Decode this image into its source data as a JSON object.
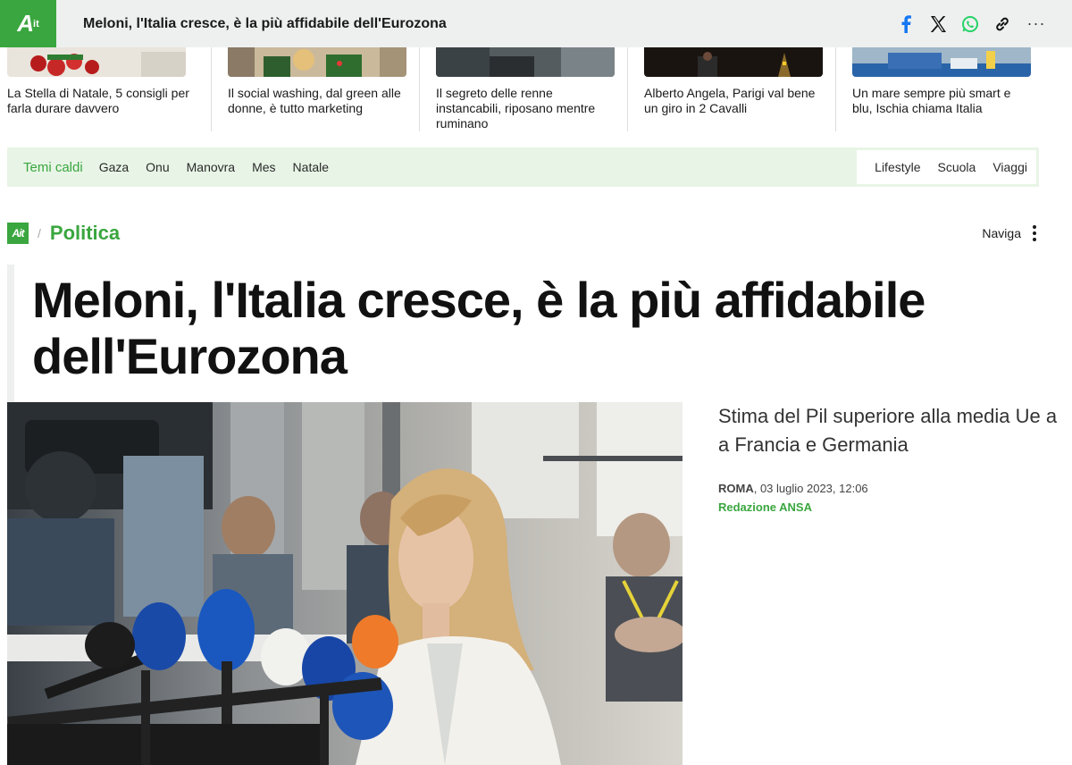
{
  "topbar": {
    "logo_text": "A",
    "logo_sup": "it",
    "title": "Meloni, l'Italia cresce, è la più affidabile dell'Eurozona",
    "share_icons": [
      "facebook-icon",
      "x-icon",
      "whatsapp-icon",
      "link-icon",
      "more-icon"
    ],
    "more_label": "···"
  },
  "related": [
    {
      "text": "La Stella di Natale, 5 consigli per farla durare davvero"
    },
    {
      "text": "Il social washing, dal green alle donne, è tutto marketing"
    },
    {
      "text": "Il segreto delle renne instancabili, riposano mentre ruminano"
    },
    {
      "text": "Alberto Angela, Parigi val bene un giro in 2 Cavalli"
    },
    {
      "text": "Un mare sempre più smart e blu, Ischia chiama Italia"
    }
  ],
  "hot_topics": {
    "label": "Temi caldi",
    "left": [
      "Gaza",
      "Onu",
      "Manovra",
      "Mes",
      "Natale"
    ],
    "right": [
      "Lifestyle",
      "Scuola",
      "Viaggi"
    ]
  },
  "breadcrumb": {
    "logo_text": "Ait",
    "separator": "/",
    "section": "Politica",
    "nav_label": "Naviga"
  },
  "article": {
    "headline": "Meloni, l'Italia cresce, è la più affidabile dell'Eurozona",
    "subtitle": "Stima del Pil superiore alla media Ue a a Francia e Germania",
    "city": "ROMA",
    "date": ", 03 luglio 2023, 12:06",
    "author": "Redazione ANSA"
  },
  "colors": {
    "brand_green": "#3aa63f",
    "hot_bg": "#e8f5e6",
    "topbar_bg": "#eef0ef"
  }
}
